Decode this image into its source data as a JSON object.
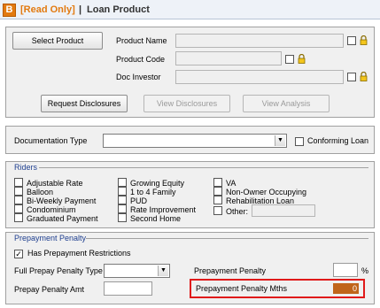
{
  "title": {
    "mode": "[Read Only]",
    "separator": "|",
    "text": "Loan Product",
    "logo": "B"
  },
  "product": {
    "select_button": "Select Product",
    "name_label": "Product Name",
    "code_label": "Product Code",
    "investor_label": "Doc Investor",
    "name_value": "",
    "code_value": "",
    "investor_value": ""
  },
  "actions": {
    "request": "Request Disclosures",
    "view_disclosures": "View Disclosures",
    "view_analysis": "View Analysis"
  },
  "documentation": {
    "label": "Documentation Type",
    "value": "",
    "conforming_label": "Conforming Loan",
    "conforming_checked": false
  },
  "riders": {
    "title": "Riders",
    "col1": [
      "Adjustable Rate",
      "Balloon",
      "Bi-Weekly Payment",
      "Condominium",
      "Graduated Payment"
    ],
    "col2": [
      "Growing Equity",
      "1 to 4 Family",
      "PUD",
      "Rate Improvement",
      "Second Home"
    ],
    "col3": [
      "VA",
      "Non-Owner Occupying",
      "Rehabilitation Loan",
      "Other:"
    ],
    "other_value": ""
  },
  "prepayment": {
    "title": "Prepayment Penalty",
    "has_restrictions_label": "Has Prepayment Restrictions",
    "has_restrictions_checked": true,
    "full_type_label": "Full Prepay Penalty Type",
    "full_type_value": "",
    "amt_label": "Prepay Penalty Amt",
    "amt_value": "",
    "penalty_label": "Prepayment Penalty",
    "penalty_value": "",
    "percent": "%",
    "mths_label": "Prepayment Penalty Mths",
    "mths_value": "0"
  },
  "colors": {
    "accent": "#e27a10",
    "highlight": "#e01a1a",
    "group_title": "#1f3f8f"
  }
}
